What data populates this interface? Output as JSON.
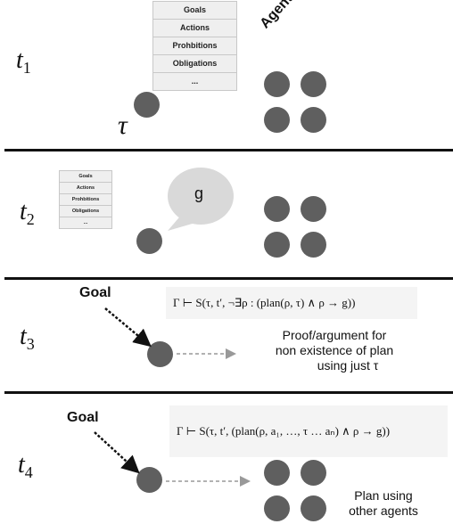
{
  "rows": [
    {
      "time_label": "t",
      "time_sub": "1"
    },
    {
      "time_label": "t",
      "time_sub": "2"
    },
    {
      "time_label": "t",
      "time_sub": "3"
    },
    {
      "time_label": "t",
      "time_sub": "4"
    }
  ],
  "norms_table": {
    "items": [
      "Goals",
      "Actions",
      "Prohbitions",
      "Obligations",
      "..."
    ]
  },
  "agent_label": "Agent",
  "tau_symbol": "τ",
  "speech_bubble_text": "g",
  "goal_label": "Goal",
  "formula_t3": "Γ ⊢ S(τ, t′, ¬∃ρ : (plan(ρ, τ) ∧ ρ → g))",
  "formula_t4": "Γ ⊢ S(τ, t′, (plan(ρ, a₁, …, τ … aₙ) ∧ ρ → g))",
  "caption_t3": [
    "Proof/argument for",
    "non existence of plan",
    "using just τ"
  ],
  "caption_t4": [
    "Plan using",
    "other agents"
  ],
  "colors": {
    "dot": "#5f5f5f",
    "table_bg": "#efefef",
    "bubble": "#d9d9d9",
    "formula_bg": "#f4f4f4",
    "arrow_gray": "#999999"
  }
}
